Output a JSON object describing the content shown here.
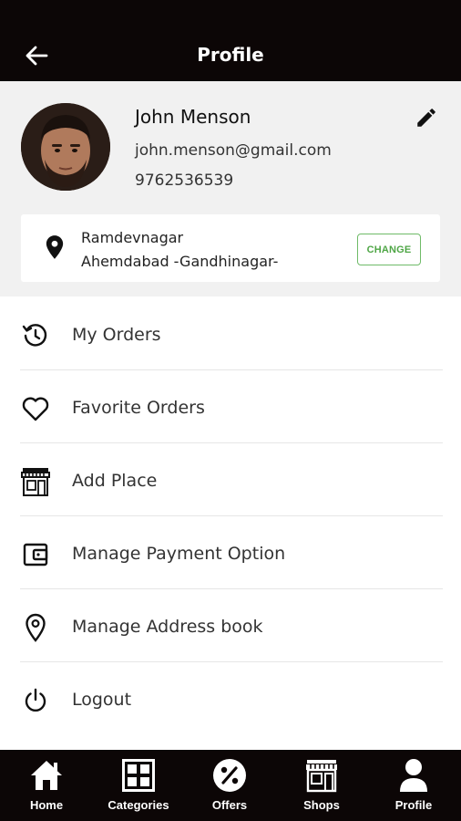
{
  "header": {
    "title": "Profile",
    "back_icon": "arrow-left-icon"
  },
  "user": {
    "name": "John Menson",
    "email": "john.menson@gmail.com",
    "phone": "9762536539"
  },
  "address": {
    "line1": "Ramdevnagar",
    "line2": "Ahemdabad -Gandhinagar-",
    "change_label": "CHANGE",
    "accent_color": "#4fa646"
  },
  "menu": {
    "items": [
      {
        "label": "My Orders",
        "icon": "history-icon"
      },
      {
        "label": "Favorite Orders",
        "icon": "heart-icon"
      },
      {
        "label": "Add Place",
        "icon": "storefront-icon"
      },
      {
        "label": "Manage Payment Option",
        "icon": "wallet-icon"
      },
      {
        "label": "Manage Address book",
        "icon": "location-pin-icon"
      },
      {
        "label": "Logout",
        "icon": "power-icon"
      }
    ]
  },
  "bottom_nav": {
    "items": [
      {
        "label": "Home",
        "icon": "home-icon"
      },
      {
        "label": "Categories",
        "icon": "grid-icon"
      },
      {
        "label": "Offers",
        "icon": "percent-icon"
      },
      {
        "label": "Shops",
        "icon": "shop-icon"
      },
      {
        "label": "Profile",
        "icon": "person-icon"
      }
    ]
  },
  "colors": {
    "bar_background": "#0c0606",
    "panel_background": "#f1f1f1"
  }
}
